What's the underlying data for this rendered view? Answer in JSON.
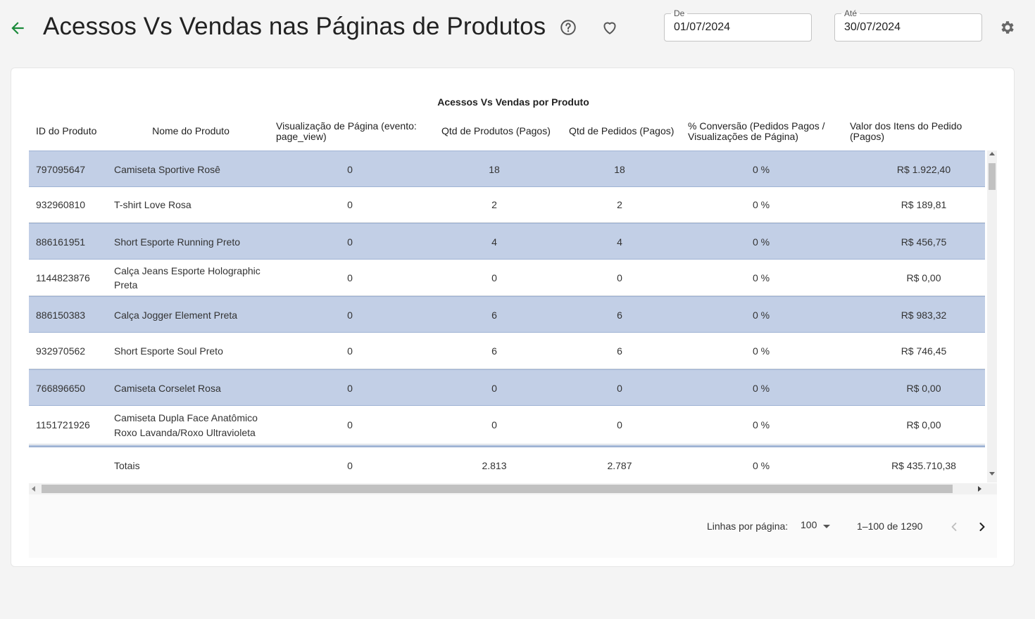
{
  "header": {
    "title": "Acessos Vs Vendas nas Páginas de Produtos",
    "date_from": {
      "label": "De",
      "value": "01/07/2024"
    },
    "date_to": {
      "label": "Até",
      "value": "30/07/2024"
    }
  },
  "table": {
    "title": "Acessos Vs Vendas por Produto",
    "columns": [
      "ID do Produto",
      "Nome do Produto",
      "Visualização de Página (evento: page_view)",
      "Qtd de Produtos (Pagos)",
      "Qtd de Pedidos (Pagos)",
      "% Conversão (Pedidos Pagos / Visualizações de Página)",
      "Valor dos Itens do Pedido (Pagos)"
    ],
    "rows": [
      {
        "id": "797095647",
        "name": "Camiseta Sportive Rosê",
        "page_views": "0",
        "qty_products": "18",
        "qty_orders": "18",
        "conversion": "0 %",
        "value": "R$ 1.922,40"
      },
      {
        "id": "932960810",
        "name": "T-shirt Love Rosa",
        "page_views": "0",
        "qty_products": "2",
        "qty_orders": "2",
        "conversion": "0 %",
        "value": "R$ 189,81"
      },
      {
        "id": "886161951",
        "name": "Short Esporte Running Preto",
        "page_views": "0",
        "qty_products": "4",
        "qty_orders": "4",
        "conversion": "0 %",
        "value": "R$ 456,75"
      },
      {
        "id": "1144823876",
        "name": "Calça Jeans Esporte Holographic Preta",
        "page_views": "0",
        "qty_products": "0",
        "qty_orders": "0",
        "conversion": "0 %",
        "value": "R$ 0,00"
      },
      {
        "id": "886150383",
        "name": "Calça Jogger Element Preta",
        "page_views": "0",
        "qty_products": "6",
        "qty_orders": "6",
        "conversion": "0 %",
        "value": "R$ 983,32"
      },
      {
        "id": "932970562",
        "name": "Short Esporte Soul Preto",
        "page_views": "0",
        "qty_products": "6",
        "qty_orders": "6",
        "conversion": "0 %",
        "value": "R$ 746,45"
      },
      {
        "id": "766896650",
        "name": "Camiseta Corselet Rosa",
        "page_views": "0",
        "qty_products": "0",
        "qty_orders": "0",
        "conversion": "0 %",
        "value": "R$ 0,00"
      },
      {
        "id": "1151721926",
        "name": "Camiseta Dupla Face Anatômico Roxo Lavanda/Roxo Ultravioleta",
        "page_views": "0",
        "qty_products": "0",
        "qty_orders": "0",
        "conversion": "0 %",
        "value": "R$ 0,00"
      }
    ],
    "totals": {
      "label": "Totais",
      "page_views": "0",
      "qty_products": "2.813",
      "qty_orders": "2.787",
      "conversion": "0 %",
      "value": "R$ 435.710,38"
    }
  },
  "pagination": {
    "rows_per_page_label": "Linhas por página:",
    "rows_per_page_value": "100",
    "range": "1–100 de 1290"
  },
  "colors": {
    "accent_green": "#1a8a3a",
    "row_highlight": "#c2cfe6"
  }
}
